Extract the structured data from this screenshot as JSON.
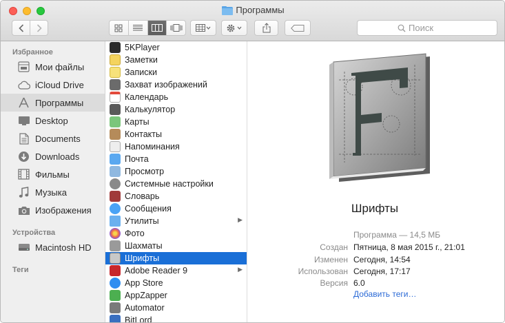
{
  "window": {
    "title": "Программы"
  },
  "search": {
    "placeholder": "Поиск"
  },
  "colors": {
    "selection": "#1a6fd7",
    "sidebar_bg": "#efefef",
    "link": "#2b6ad6"
  },
  "sidebar": {
    "sections": [
      {
        "header": "Избранное"
      },
      {
        "header": "Устройства"
      },
      {
        "header": "Теги"
      }
    ],
    "favorites": [
      {
        "label": "Мои файлы",
        "icon": "all-files-icon"
      },
      {
        "label": "iCloud Drive",
        "icon": "cloud-icon"
      },
      {
        "label": "Программы",
        "icon": "applications-icon",
        "selected": true
      },
      {
        "label": "Desktop",
        "icon": "desktop-icon"
      },
      {
        "label": "Documents",
        "icon": "documents-icon"
      },
      {
        "label": "Downloads",
        "icon": "downloads-icon"
      },
      {
        "label": "Фильмы",
        "icon": "movies-icon"
      },
      {
        "label": "Музыка",
        "icon": "music-icon"
      },
      {
        "label": "Изображения",
        "icon": "camera-icon"
      }
    ],
    "devices": [
      {
        "label": "Macintosh HD",
        "icon": "hard-drive-icon"
      }
    ]
  },
  "apps": [
    {
      "name": "5KPlayer",
      "color": "#333333"
    },
    {
      "name": "Заметки",
      "color": "#f4d35e"
    },
    {
      "name": "Записки",
      "color": "#f7e27a"
    },
    {
      "name": "Захват изображений",
      "color": "#6b6b6b"
    },
    {
      "name": "Календарь",
      "color": "#ffffff"
    },
    {
      "name": "Калькулятор",
      "color": "#5a5a5a"
    },
    {
      "name": "Карты",
      "color": "#7bc67b"
    },
    {
      "name": "Контакты",
      "color": "#b58b5a"
    },
    {
      "name": "Напоминания",
      "color": "#eeeeee"
    },
    {
      "name": "Почта",
      "color": "#5aa8f0"
    },
    {
      "name": "Просмотр",
      "color": "#8fb8e0"
    },
    {
      "name": "Системные настройки",
      "color": "#8a8a8a"
    },
    {
      "name": "Словарь",
      "color": "#a03a3a"
    },
    {
      "name": "Сообщения",
      "color": "#4aa3f5"
    },
    {
      "name": "Утилиты",
      "color": "#6ab0ef",
      "folder": true
    },
    {
      "name": "Фото",
      "color": "#f2a93b"
    },
    {
      "name": "Шахматы",
      "color": "#9a9a9a"
    },
    {
      "name": "Шрифты",
      "color": "#c8c8c8",
      "selected": true
    },
    {
      "name": "Adobe Reader 9",
      "color": "#c8262b",
      "folder": true
    },
    {
      "name": "App Store",
      "color": "#2f8ef0"
    },
    {
      "name": "AppZapper",
      "color": "#4caf50"
    },
    {
      "name": "Automator",
      "color": "#7a7a7a"
    },
    {
      "name": "BitLord",
      "color": "#3a6fbf"
    }
  ],
  "preview": {
    "icon": "font-book-icon",
    "name": "Шрифты",
    "kind": "Программа — 14,5 МБ",
    "meta": [
      {
        "label": "Создан",
        "value": "Пятница, 8 мая 2015 г., 21:01"
      },
      {
        "label": "Изменен",
        "value": "Сегодня, 14:54"
      },
      {
        "label": "Использован",
        "value": "Сегодня, 17:17"
      },
      {
        "label": "Версия",
        "value": "6.0"
      }
    ],
    "add_tags": "Добавить теги…"
  }
}
